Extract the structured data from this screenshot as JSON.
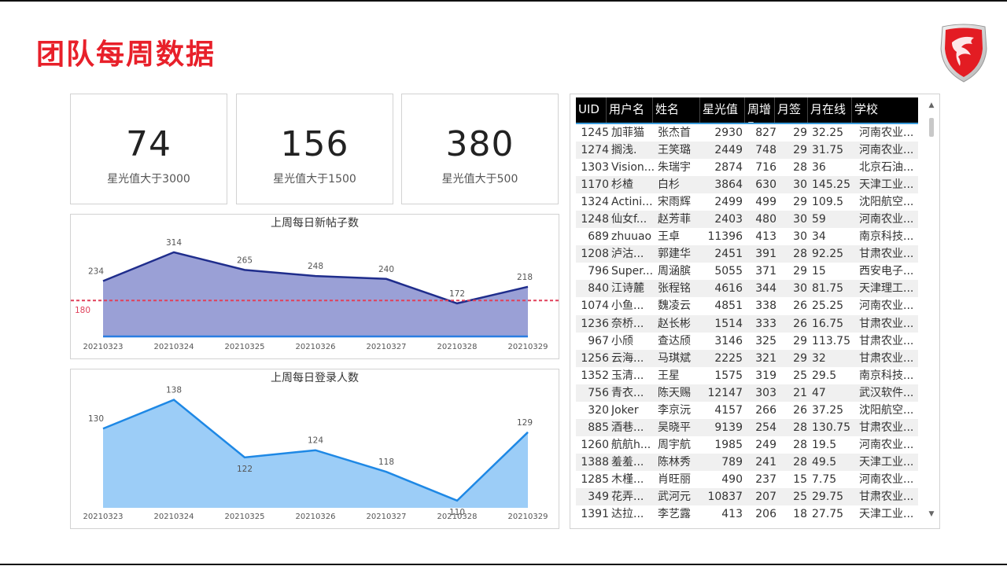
{
  "page": {
    "title": "团队每周数据"
  },
  "kpis": [
    {
      "value": "74",
      "label": "星光值大于3000"
    },
    {
      "value": "156",
      "label": "星光值大于1500"
    },
    {
      "value": "380",
      "label": "星光值大于500"
    }
  ],
  "chart_data": [
    {
      "type": "area",
      "title": "上周每日新帖子数",
      "categories": [
        "20210323",
        "20210324",
        "20210325",
        "20210326",
        "20210327",
        "20210328",
        "20210329"
      ],
      "series": [
        {
          "values": [
            234,
            314,
            265,
            248,
            240,
            172,
            218
          ]
        }
      ],
      "reference_line": {
        "value": 180,
        "label": "180",
        "color": "#e0405a"
      },
      "colors": {
        "line": "#1f2d8c",
        "fill": "#9aa0d6",
        "baseline": "#2a7de1"
      },
      "ylim": [
        80,
        340
      ]
    },
    {
      "type": "area",
      "title": "上周每日登录人数",
      "categories": [
        "20210323",
        "20210324",
        "20210325",
        "20210326",
        "20210327",
        "20210328",
        "20210329"
      ],
      "series": [
        {
          "values": [
            130,
            138,
            122,
            124,
            118,
            110,
            129
          ]
        }
      ],
      "colors": {
        "line": "#1e88e5",
        "fill": "#9ccdf7"
      },
      "ylim": [
        108,
        139
      ]
    }
  ],
  "table": {
    "columns": [
      "UID",
      "用户名",
      "姓名",
      "星光值",
      "周增",
      "月签",
      "月在线",
      "学校"
    ],
    "sorted_column": "周增",
    "rows": [
      [
        "1245",
        "加菲猫",
        "张杰首",
        "2930",
        "827",
        "29",
        "32.25",
        "河南农业..."
      ],
      [
        "1274",
        "搁浅.",
        "王笑璐",
        "2449",
        "748",
        "29",
        "31.75",
        "河南农业..."
      ],
      [
        "1303",
        "Vision...",
        "朱瑞宇",
        "2874",
        "716",
        "28",
        "36",
        "北京石油..."
      ],
      [
        "1170",
        "杉楂",
        "白杉",
        "3864",
        "630",
        "30",
        "145.25",
        "天津工业..."
      ],
      [
        "1324",
        "Actini...",
        "宋雨辉",
        "2499",
        "499",
        "29",
        "109.5",
        "沈阳航空..."
      ],
      [
        "1248",
        "仙女f...",
        "赵芳菲",
        "2403",
        "480",
        "30",
        "59",
        "河南农业..."
      ],
      [
        "689",
        "zhuuao",
        "王卓",
        "11396",
        "413",
        "30",
        "34",
        "南京科技..."
      ],
      [
        "1208",
        "泸沽...",
        "郭建华",
        "2451",
        "391",
        "28",
        "92.25",
        "甘肃农业..."
      ],
      [
        "796",
        "Super...",
        "周涵膑",
        "5055",
        "371",
        "29",
        "15",
        "西安电子..."
      ],
      [
        "840",
        "江诗麓",
        "张程铭",
        "4616",
        "344",
        "30",
        "81.75",
        "天津理工..."
      ],
      [
        "1074",
        "小鱼...",
        "魏凌云",
        "4851",
        "338",
        "26",
        "25.25",
        "河南农业..."
      ],
      [
        "1236",
        "奈桥...",
        "赵长彬",
        "1514",
        "333",
        "26",
        "16.75",
        "甘肃农业..."
      ],
      [
        "967",
        "小颀",
        "查达颀",
        "3146",
        "325",
        "29",
        "113.75",
        "甘肃农业..."
      ],
      [
        "1256",
        "云海...",
        "马琪斌",
        "2225",
        "321",
        "29",
        "32",
        "甘肃农业..."
      ],
      [
        "1352",
        "玉清...",
        "王星",
        "1575",
        "319",
        "25",
        "29.5",
        "南京科技..."
      ],
      [
        "756",
        "青衣...",
        "陈天赐",
        "12147",
        "303",
        "21",
        "47",
        "武汉软件..."
      ],
      [
        "320",
        "Joker",
        "李京沅",
        "4157",
        "266",
        "26",
        "37.25",
        "沈阳航空..."
      ],
      [
        "885",
        "酒巷...",
        "吴晓平",
        "9139",
        "254",
        "28",
        "130.75",
        "甘肃农业..."
      ],
      [
        "1260",
        "航航h...",
        "周宇航",
        "1985",
        "249",
        "28",
        "19.5",
        "河南农业..."
      ],
      [
        "1388",
        "羞羞...",
        "陈林秀",
        "789",
        "241",
        "28",
        "49.5",
        "天津工业..."
      ],
      [
        "1285",
        "木槿...",
        "肖旺丽",
        "490",
        "237",
        "15",
        "7.75",
        "河南农业..."
      ],
      [
        "349",
        "花弄...",
        "武河元",
        "10837",
        "207",
        "25",
        "29.75",
        "甘肃农业..."
      ],
      [
        "1391",
        "达拉...",
        "李艺露",
        "413",
        "206",
        "18",
        "27.75",
        "天津工业..."
      ]
    ]
  }
}
